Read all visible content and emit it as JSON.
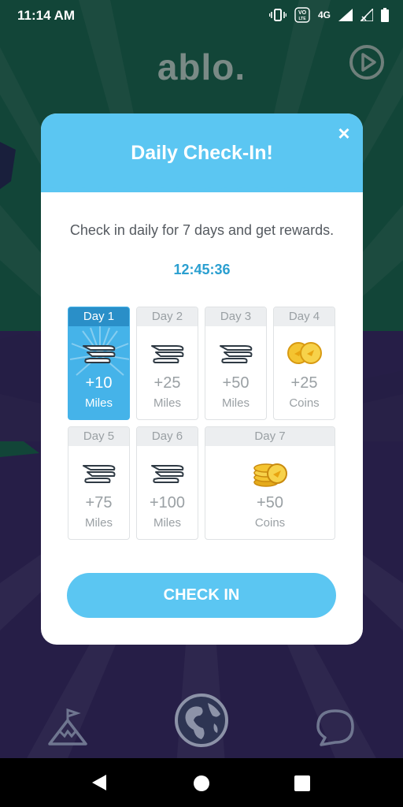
{
  "status_bar": {
    "time": "11:14 AM",
    "network": "4G"
  },
  "app": {
    "logo": "ablo."
  },
  "modal": {
    "title": "Daily Check-In!",
    "close_label": "×",
    "description": "Check in daily for 7 days and get rewards.",
    "timer": "12:45:36",
    "check_in_label": "CHECK IN"
  },
  "days": [
    {
      "label": "Day 1",
      "amount": "+10",
      "unit": "Miles",
      "icon": "wings-icon",
      "active": true
    },
    {
      "label": "Day 2",
      "amount": "+25",
      "unit": "Miles",
      "icon": "wings-icon",
      "active": false
    },
    {
      "label": "Day 3",
      "amount": "+50",
      "unit": "Miles",
      "icon": "wings-icon",
      "active": false
    },
    {
      "label": "Day 4",
      "amount": "+25",
      "unit": "Coins",
      "icon": "coins-icon",
      "active": false
    },
    {
      "label": "Day 5",
      "amount": "+75",
      "unit": "Miles",
      "icon": "wings-icon",
      "active": false
    },
    {
      "label": "Day 6",
      "amount": "+100",
      "unit": "Miles",
      "icon": "wings-icon",
      "active": false
    },
    {
      "label": "Day 7",
      "amount": "+50",
      "unit": "Coins",
      "icon": "coin-stack-icon",
      "active": false
    }
  ],
  "nav": {
    "items": [
      {
        "icon": "mountain-flag-icon"
      },
      {
        "icon": "globe-icon",
        "selected": true
      },
      {
        "icon": "chat-bubble-icon"
      }
    ]
  },
  "colors": {
    "accent": "#5bc6f2",
    "active_day": "#45b3e9",
    "timer": "#2a9fd0"
  }
}
